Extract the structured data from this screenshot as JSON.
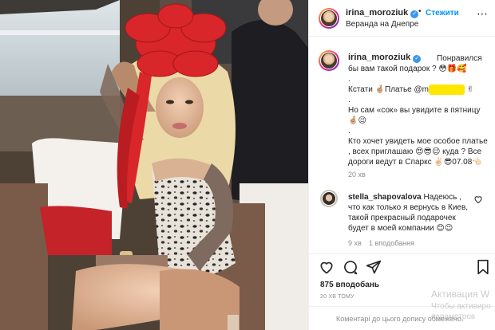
{
  "post": {
    "username": "irina_moroziuk",
    "verified_mark": "✓",
    "follow_label": "Стежити",
    "location": "Веранда на Днепре",
    "caption_lines": [
      "Понравился бы вам такой подарок ? 😳🎁🥰",
      ".",
      "Кстати 🤞🏼Платье @m",
      ".",
      "Но сам «сок» вы увидите в пятницу 🤞🏼😉",
      ".",
      "Кто хочет увидеть мое особое платье , всех приглашаю 😍😎😉 куда ? Все дороги ведут в Спаркс ✌🏻😎07.08👈🏻"
    ],
    "caption_time": "20 хв",
    "likes": "875 вподобань",
    "time_ago": "20 ХВ ТОМУ",
    "comment_placeholder": "Коментарі до цього допису обмежено."
  },
  "comment": {
    "username": "stella_shapovalova",
    "text": "Надеюсь , что как только я вернусь в Киев, такой прекрасный подарочек будет в моей компании 😊😉",
    "time": "9 хв",
    "likes": "1 вподобання"
  },
  "watermark": {
    "line1": "Активация W",
    "line2": "Чтобы активиро",
    "line3": "параметров"
  },
  "icons": [
    "heart-icon",
    "comment-icon",
    "share-icon",
    "bookmark-icon",
    "more-icon",
    "small-heart-icon"
  ]
}
